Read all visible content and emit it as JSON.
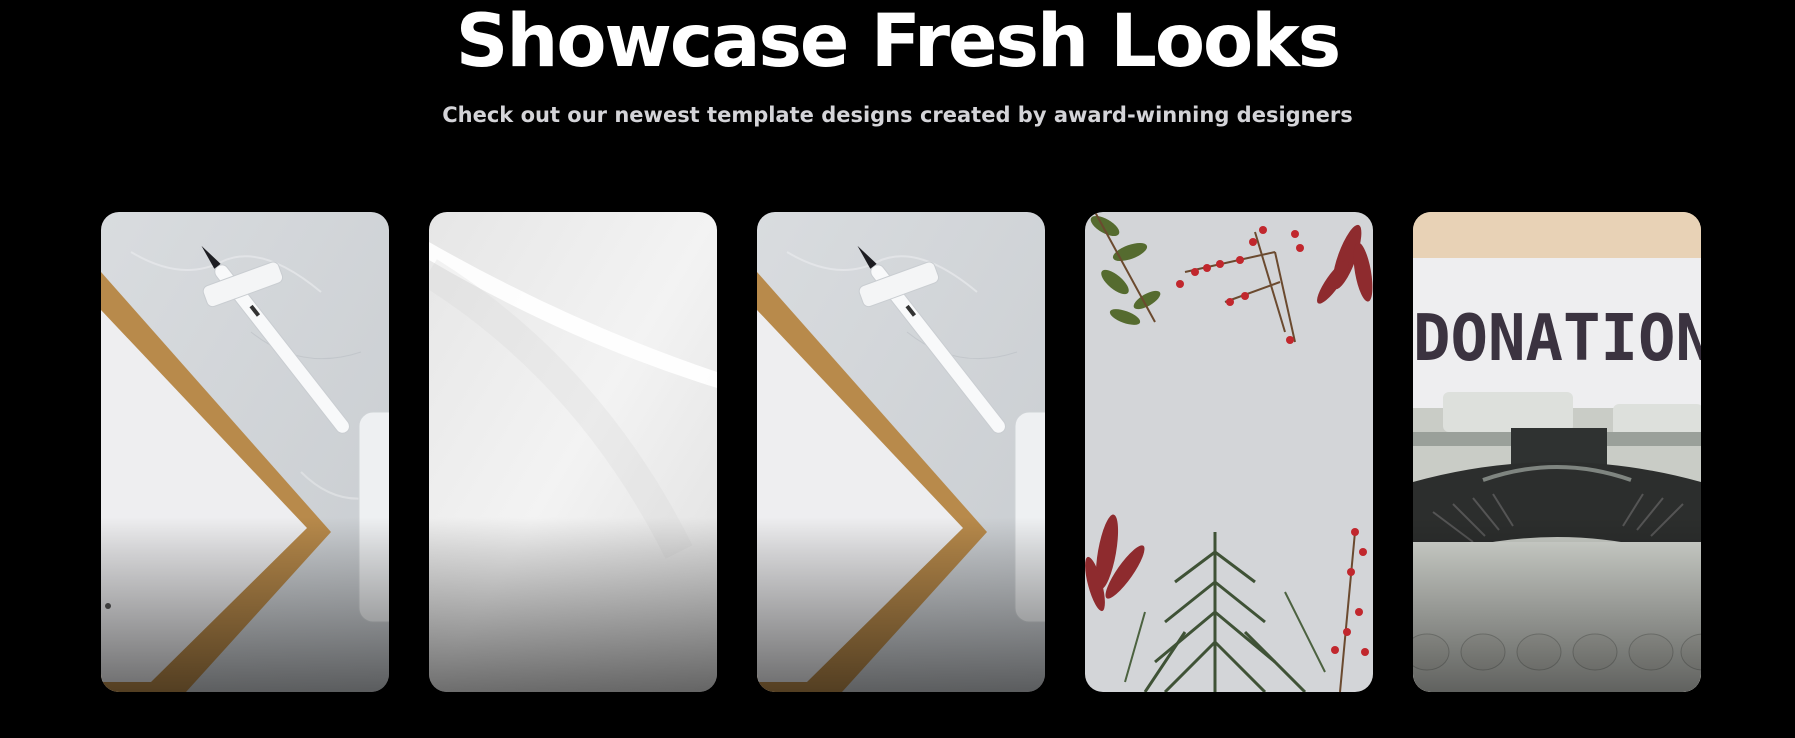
{
  "hero": {
    "title": "Showcase Fresh Looks",
    "subtitle": "Check out our newest template designs created by award-winning designers"
  },
  "templates": [
    {
      "name": "clipboard-pen-template",
      "icon": "clipboard-pen-image"
    },
    {
      "name": "white-minimal-template",
      "icon": "white-abstract-image"
    },
    {
      "name": "clipboard-pen-template-2",
      "icon": "clipboard-pen-image"
    },
    {
      "name": "winter-botanical-template",
      "icon": "berries-foliage-image"
    },
    {
      "name": "donation-typewriter-template",
      "icon": "typewriter-image",
      "image_text": "DONATION"
    }
  ]
}
